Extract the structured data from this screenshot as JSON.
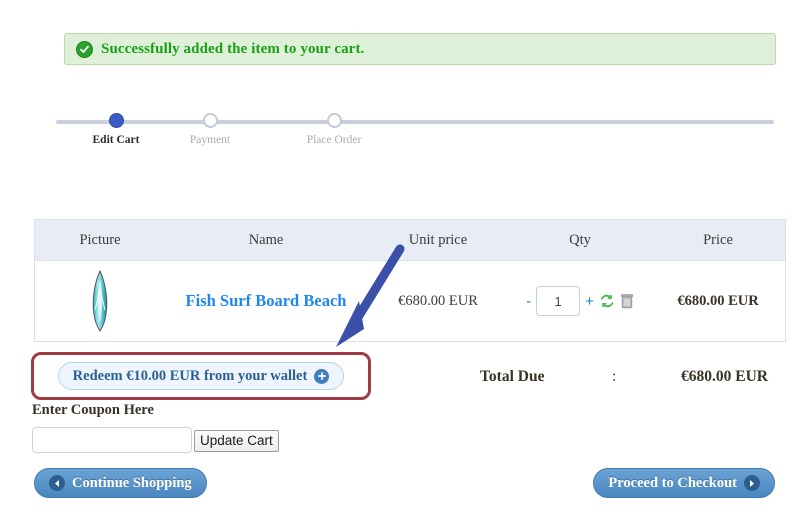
{
  "alert": {
    "icon": "check-circle-icon",
    "message": "Successfully added the item to your cart.",
    "text_color": "#18a018",
    "bg_color": "#dff0d8"
  },
  "stepper": {
    "steps": [
      {
        "label": "Edit Cart",
        "state": "active"
      },
      {
        "label": "Payment",
        "state": "inactive"
      },
      {
        "label": "Place Order",
        "state": "inactive"
      }
    ],
    "active_color": "#3b5bc0",
    "line_color": "#c9cfdb"
  },
  "cart": {
    "columns": [
      "Picture",
      "Name",
      "Unit price",
      "Qty",
      "Price"
    ],
    "rows": [
      {
        "picture_alt": "surfboard-thumbnail",
        "name": "Fish Surf Board Beach",
        "unit_price": "€680.00 EUR",
        "qty": "1",
        "qty_minus": "-",
        "qty_plus": "+",
        "refresh_icon": "refresh-icon",
        "delete_icon": "trash-icon",
        "price": "€680.00 EUR"
      }
    ]
  },
  "wallet": {
    "redeem_label": "Redeem €10.00 EUR from your wallet",
    "plus_icon": "plus-circle-icon",
    "highlight_color": "#9e3b43"
  },
  "totals": {
    "label": "Total Due",
    "separator": ":",
    "value": "€680.00 EUR"
  },
  "coupon": {
    "label": "Enter Coupon Here",
    "value": "",
    "placeholder": "",
    "update_button": "Update Cart"
  },
  "footer": {
    "continue_label": "Continue Shopping",
    "continue_icon": "arrow-left-circle-icon",
    "checkout_label": "Proceed to Checkout",
    "checkout_icon": "arrow-right-circle-icon",
    "button_color": "#4a86bf"
  },
  "annotation": {
    "type": "arrow",
    "direction": "down-left",
    "color": "#3a4fa8"
  }
}
